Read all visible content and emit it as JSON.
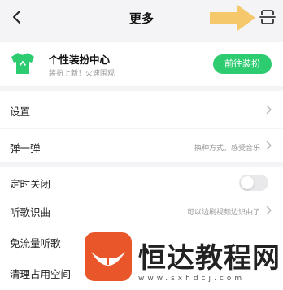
{
  "header": {
    "title": "更多"
  },
  "banner": {
    "title": "个性装扮中心",
    "subtitle": "装扮上新！火速围观",
    "button": "前往装扮"
  },
  "rows": {
    "settings": "设置",
    "popup": {
      "label": "弹一弹",
      "hint": "换种方式，感受音乐"
    },
    "timer": "定时关闭",
    "song_recognition": {
      "label": "听歌识曲",
      "hint": "可以边刷视频边识曲了"
    },
    "free_data": "免流量听歌",
    "cleanup": "清理占用空间"
  },
  "watermark": {
    "text": "恒达教程网",
    "url": "www.sxhdcj.com"
  },
  "colors": {
    "accent": "#2ecc71",
    "arrow": "#f5c86b",
    "watermark": "#e8562a"
  }
}
